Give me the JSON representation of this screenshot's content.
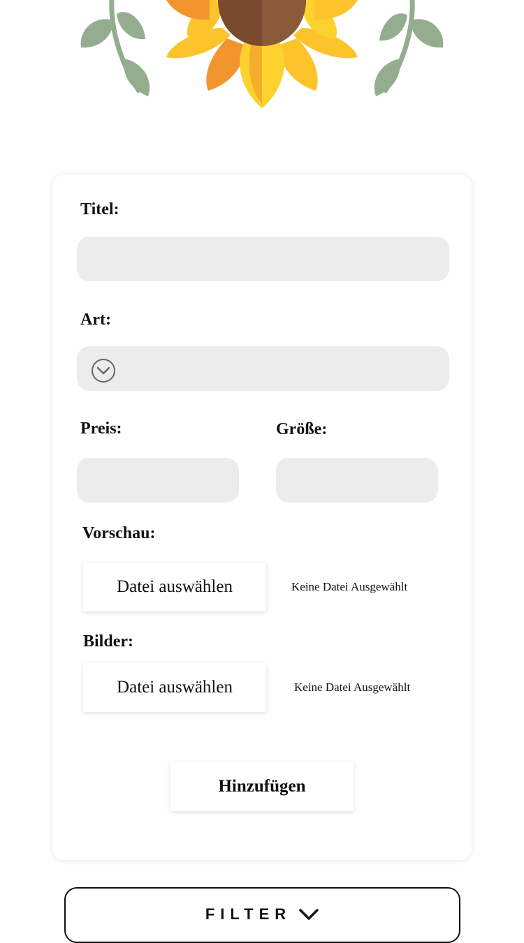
{
  "form": {
    "title_label": "Titel:",
    "title_value": "",
    "type_label": "Art:",
    "type_value": "",
    "price_label": "Preis:",
    "price_value": "",
    "size_label": "Größe:",
    "size_value": "",
    "preview_label": "Vorschau:",
    "preview_button": "Datei auswählen",
    "preview_status": "Keine Datei Ausgewählt",
    "images_label": "Bilder:",
    "images_button": "Datei auswählen",
    "images_status": "Keine Datei Ausgewählt",
    "submit_label": "Hinzufügen"
  },
  "filter": {
    "label": "FILTER"
  },
  "icons": {
    "header": "sunflower-illustration",
    "select": "chevron-down-circle-icon",
    "filter": "chevron-down-icon"
  },
  "colors": {
    "field_background": "#ececec",
    "petal_dark": "#f2952f",
    "petal_light": "#fcc42a",
    "flower_center": "#7a4a2e",
    "leaf_green": "#94ad8f"
  }
}
